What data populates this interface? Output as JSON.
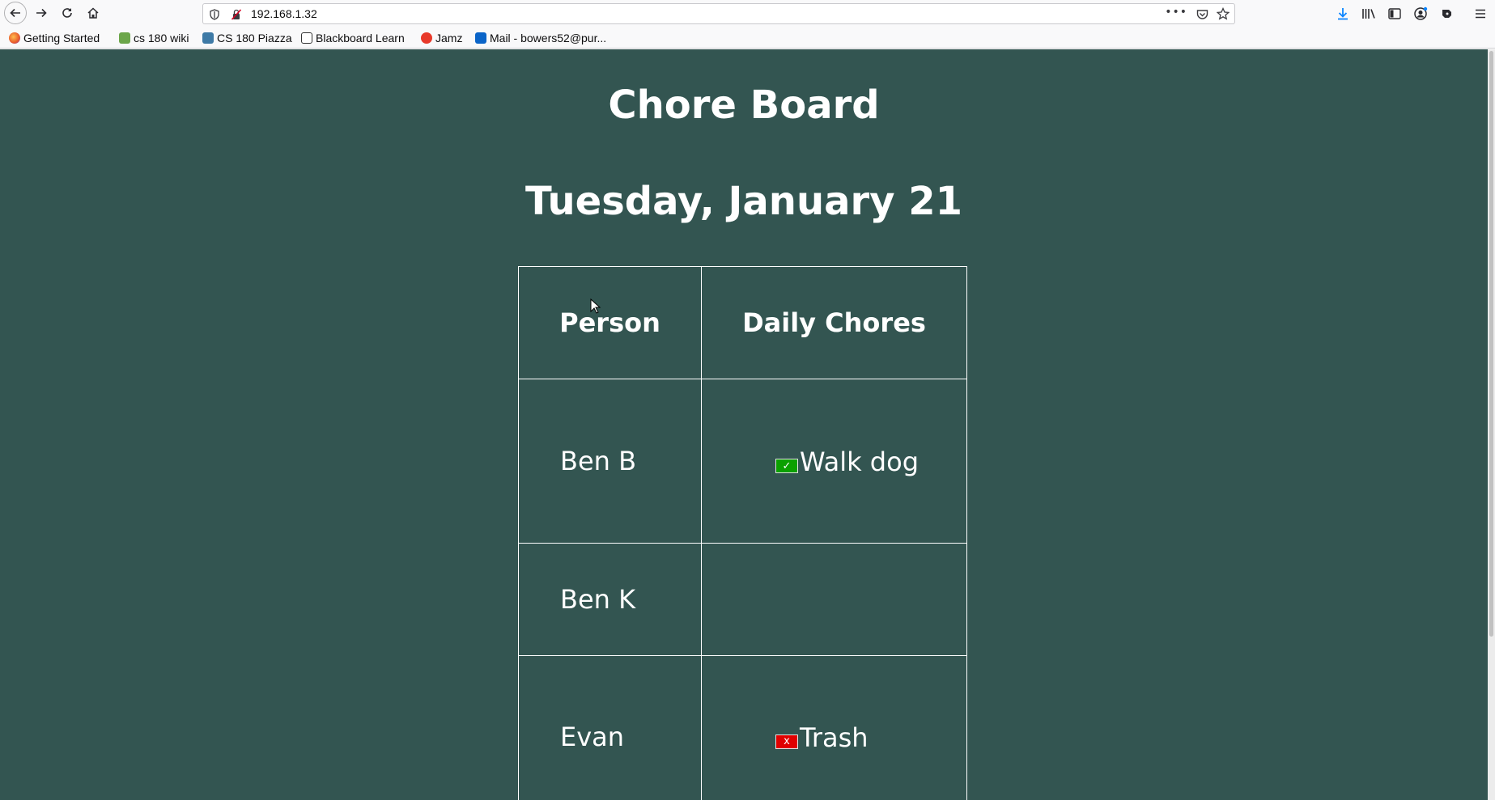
{
  "browser": {
    "url": "192.168.1.32",
    "bookmarks": [
      {
        "label": "Getting Started",
        "color": "#e8592a"
      },
      {
        "label": "cs 180 wiki",
        "color": "#6ca64a"
      },
      {
        "label": "CS 180 Piazza",
        "color": "#3e7aa6"
      },
      {
        "label": "Blackboard Learn",
        "color": "#333333"
      },
      {
        "label": "Jamz",
        "color": "#e8392a"
      },
      {
        "label": "Mail - bowers52@pur...",
        "color": "#0a64c8"
      }
    ]
  },
  "page": {
    "title": "Chore Board",
    "date": "Tuesday, January 21",
    "background": "#335551",
    "table": {
      "headers": {
        "person": "Person",
        "chores": "Daily Chores"
      },
      "rows": [
        {
          "person": "Ben B",
          "chore": "Walk dog",
          "status": "done",
          "status_glyph": "✓"
        },
        {
          "person": "Ben K",
          "chore": "",
          "status": "",
          "status_glyph": ""
        },
        {
          "person": "Evan",
          "chore": "Trash",
          "status": "todo",
          "status_glyph": "x"
        }
      ]
    }
  },
  "colors": {
    "done": "#0ba000",
    "todo": "#e00000"
  }
}
